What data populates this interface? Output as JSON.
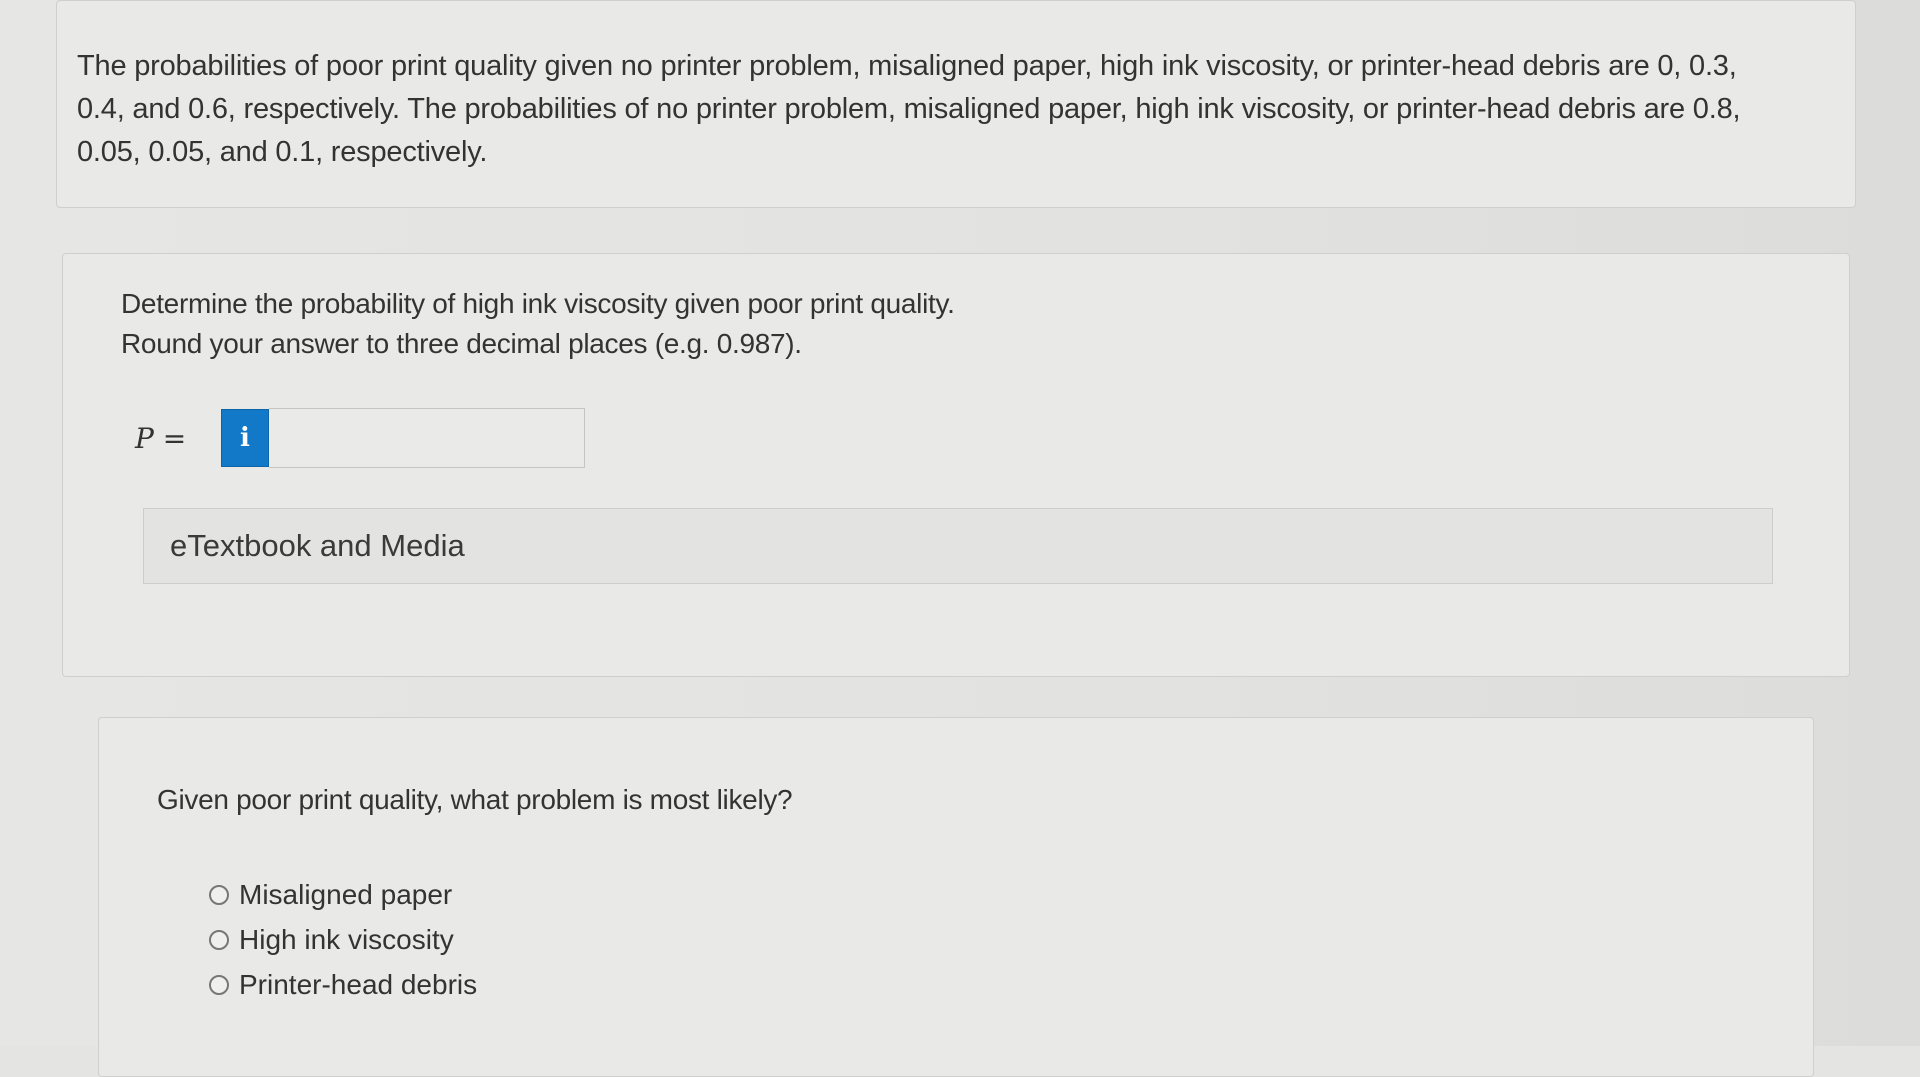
{
  "problem": {
    "text_line1": "The probabilities of poor print quality given no printer problem, misaligned paper, high ink viscosity, or printer-head debris are 0, 0.3,",
    "text_line2": "0.4, and 0.6, respectively. The probabilities of no printer problem, misaligned paper, high ink viscosity, or printer-head debris are 0.8,",
    "text_line3": "0.05, 0.05, and 0.1, respectively."
  },
  "part1": {
    "question_line1": "Determine the probability of high ink viscosity given poor print quality.",
    "question_line2": "Round your answer to three decimal places (e.g. 0.987).",
    "answer_label": "P =",
    "info_icon_glyph": "i",
    "answer_value": "",
    "etextbook_label": "eTextbook and Media"
  },
  "part2": {
    "question": "Given poor print quality, what problem is most likely?",
    "options": [
      {
        "label": "Misaligned paper"
      },
      {
        "label": "High ink viscosity"
      },
      {
        "label": "Printer-head debris"
      }
    ]
  },
  "colors": {
    "info_button": "#1278c8",
    "background": "#e4e4e2",
    "text": "#333333"
  },
  "icons": {
    "info": "info-icon",
    "radio": "radio-icon"
  }
}
